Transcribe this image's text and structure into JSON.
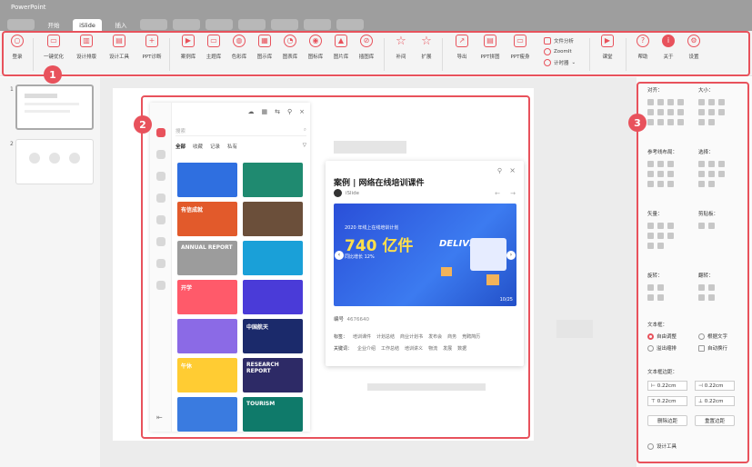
{
  "app": {
    "title": "PowerPoint"
  },
  "tabs": [
    {
      "label": ""
    },
    {
      "label": "开始"
    },
    {
      "label": "iSlide"
    },
    {
      "label": "插入"
    },
    {
      "label": ""
    },
    {
      "label": ""
    },
    {
      "label": ""
    },
    {
      "label": ""
    },
    {
      "label": ""
    },
    {
      "label": ""
    },
    {
      "label": ""
    }
  ],
  "ribbon": {
    "items": [
      {
        "label": "登录",
        "icon": "user-icon"
      },
      {
        "label": "一键优化",
        "icon": "optimize-icon"
      },
      {
        "label": "设计排版",
        "icon": "layout-icon"
      },
      {
        "label": "设计工具",
        "icon": "design-tools-icon"
      },
      {
        "label": "PPT诊断",
        "icon": "diagnose-icon"
      },
      {
        "label": "案例库",
        "icon": "case-library-icon"
      },
      {
        "label": "主题库",
        "icon": "theme-library-icon"
      },
      {
        "label": "色彩库",
        "icon": "color-library-icon"
      },
      {
        "label": "图示库",
        "icon": "diagram-library-icon"
      },
      {
        "label": "图表库",
        "icon": "chart-library-icon"
      },
      {
        "label": "图标库",
        "icon": "icon-library-icon"
      },
      {
        "label": "图片库",
        "icon": "image-library-icon"
      },
      {
        "label": "插图库",
        "icon": "illustration-library-icon"
      },
      {
        "label": "补间",
        "icon": "star-icon"
      },
      {
        "label": "扩展",
        "icon": "star-outline-icon"
      },
      {
        "label": "导出",
        "icon": "export-icon"
      },
      {
        "label": "PPT拼图",
        "icon": "puzzle-icon"
      },
      {
        "label": "PPT瘦身",
        "icon": "slim-icon"
      },
      {
        "label": "课堂",
        "icon": "classroom-icon"
      },
      {
        "label": "帮助",
        "icon": "help-icon"
      },
      {
        "label": "关于",
        "icon": "info-icon"
      },
      {
        "label": "设置",
        "icon": "gear-icon"
      }
    ],
    "list": [
      {
        "label": "文件分析"
      },
      {
        "label": "ZoomIt"
      },
      {
        "label": "计时器"
      }
    ]
  },
  "badges": {
    "one": "1",
    "two": "2",
    "three": "3"
  },
  "slides": {
    "n1": "1",
    "n2": "2"
  },
  "panel": {
    "search_placeholder": "搜索",
    "filters": [
      "全部",
      "收藏",
      "记录",
      "私有"
    ]
  },
  "cards": [
    {
      "text": "",
      "color": "#2f6fe0"
    },
    {
      "text": "",
      "color": "#1f8a70"
    },
    {
      "text": "有信成就",
      "color": "#e25a2b"
    },
    {
      "text": "",
      "color": "#6b4f3a"
    },
    {
      "text": "ANNUAL REPORT",
      "color": "#9c9c9c"
    },
    {
      "text": "",
      "color": "#1aa0d8"
    },
    {
      "text": "开学",
      "color": "#ff5a6a"
    },
    {
      "text": "",
      "color": "#4a3bd8"
    },
    {
      "text": "",
      "color": "#8b6ae6"
    },
    {
      "text": "中国航天",
      "color": "#1b2a6b"
    },
    {
      "text": "午休",
      "color": "#ffcc33"
    },
    {
      "text": "RESEARCH REPORT",
      "color": "#2d2a66"
    },
    {
      "text": "",
      "color": "#3a7be0"
    },
    {
      "text": "TOURISM",
      "color": "#0f7a6a"
    }
  ],
  "template": {
    "title": "案例 | 网络在线培训课件",
    "author": "iSlide",
    "img_small1": "2020 年线上在线培训计划",
    "img_big": "740 亿件",
    "img_small2": "同比增长 12%",
    "img_delivery": "DELIVERY",
    "pager": "10/25",
    "code_label": "编号",
    "code_value": "4676640",
    "tag_label": "标签：",
    "tags": [
      "培训课件",
      "计划总结",
      "商业计划书",
      "发布会",
      "商务",
      "竞聘简历"
    ],
    "key_label": "关键词：",
    "keys": [
      "企业介绍",
      "工作总结",
      "培训讲义",
      "物流",
      "发展",
      "数据"
    ]
  },
  "right": {
    "align": "对齐：",
    "size": "大小：",
    "ref": "参考线布局：",
    "select": "选择：",
    "vector": "矢量：",
    "clip": "剪贴板：",
    "rotate": "旋转：",
    "flip": "翻转：",
    "textbox": "文本框：",
    "opt1": "自由调整",
    "opt2": "溢出缩排",
    "opt3": "根据文字",
    "opt4": "自动换行",
    "margin": "文本框边距：",
    "m1": "0.22cm",
    "m2": "0.22cm",
    "m3": "0.22cm",
    "m4": "0.22cm",
    "del": "删除边距",
    "reset": "重置边距",
    "tools": "设计工具"
  }
}
